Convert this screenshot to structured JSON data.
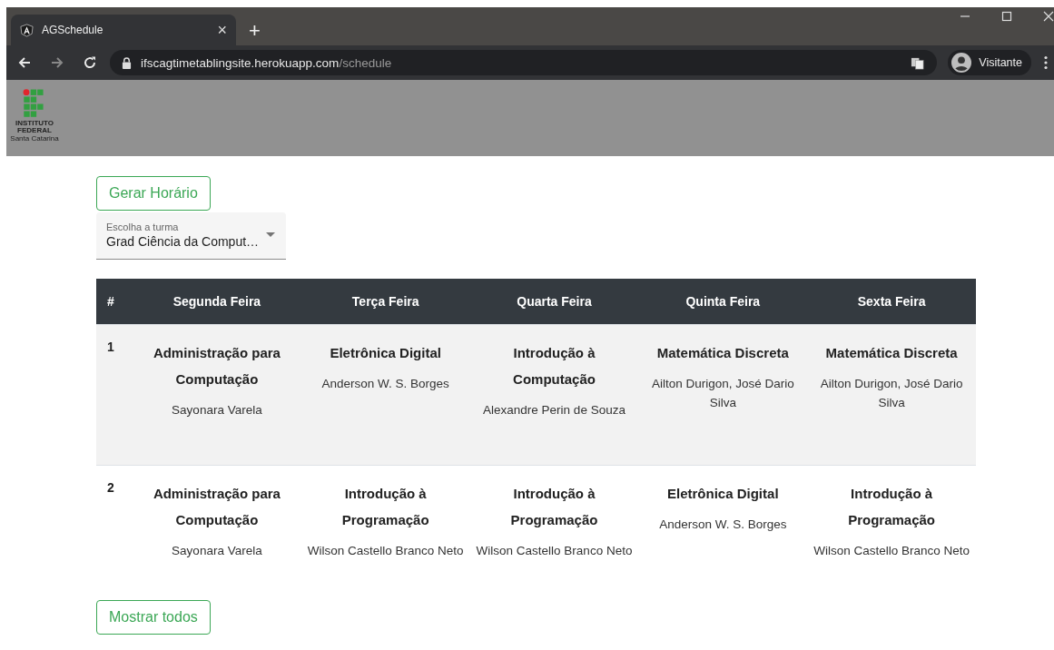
{
  "browser": {
    "tab_title": "AGSchedule",
    "tab_close": "×",
    "new_tab": "+",
    "url_host": "ifscagtimetablingsite.herokuapp.com",
    "url_path": "/schedule",
    "profile": "Visitante"
  },
  "logo": {
    "line1": "INSTITUTO",
    "line2": "FEDERAL",
    "line3": "Santa Catarina"
  },
  "generate_button": "Gerar Horário",
  "class_select": {
    "label": "Escolha a turma",
    "value": "Grad Ciência da Comput…"
  },
  "table": {
    "number_header": "#",
    "columns": [
      "Segunda Feira",
      "Terça Feira",
      "Quarta Feira",
      "Quinta Feira",
      "Sexta Feira"
    ],
    "rows": [
      {
        "number": "1",
        "cells": [
          {
            "subject": "Administração para Computação",
            "teacher": "Sayonara Varela"
          },
          {
            "subject": "Eletrônica Digital",
            "teacher": "Anderson W. S. Borges"
          },
          {
            "subject": "Introdução à Computação",
            "teacher": "Alexandre Perin de Souza"
          },
          {
            "subject": "Matemática Discreta",
            "teacher": "Ailton Durigon, José Dario Silva"
          },
          {
            "subject": "Matemática Discreta",
            "teacher": "Ailton Durigon, José Dario Silva"
          }
        ]
      },
      {
        "number": "2",
        "cells": [
          {
            "subject": "Administração para Computação",
            "teacher": "Sayonara Varela"
          },
          {
            "subject": "Introdução à Programação",
            "teacher": "Wilson Castello Branco Neto"
          },
          {
            "subject": "Introdução à Programação",
            "teacher": "Wilson Castello Branco Neto"
          },
          {
            "subject": "Eletrônica Digital",
            "teacher": "Anderson W. S. Borges"
          },
          {
            "subject": "Introdução à Programação",
            "teacher": "Wilson Castello Branco Neto"
          }
        ]
      }
    ]
  },
  "show_all_button": "Mostrar todos"
}
